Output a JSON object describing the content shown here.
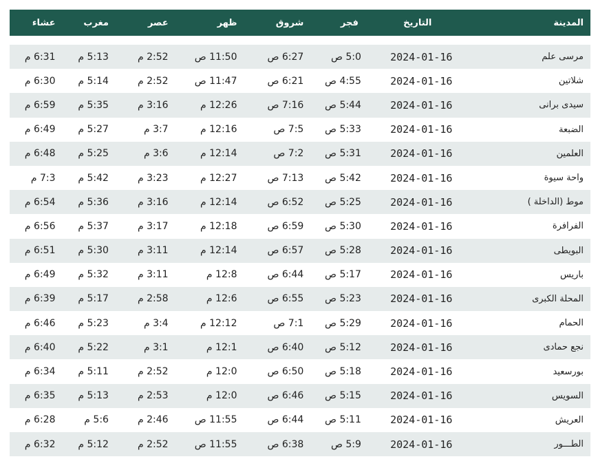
{
  "table": {
    "headers": [
      "المدينة",
      "التاريخ",
      "فجر",
      "شروق",
      "ظهر",
      "عصر",
      "مغرب",
      "عشاء"
    ],
    "rows": [
      [
        "مرسى علم",
        "2024-01-16",
        "5:0 ص",
        "6:27 ص",
        "11:50 ص",
        "2:52 م",
        "5:13 م",
        "6:31 م"
      ],
      [
        "شلاتين",
        "2024-01-16",
        "4:55 ص",
        "6:21 ص",
        "11:47 ص",
        "2:52 م",
        "5:14 م",
        "6:30 م"
      ],
      [
        "سيدى برانى",
        "2024-01-16",
        "5:44 ص",
        "7:16 ص",
        "12:26 م",
        "3:16 م",
        "5:35 م",
        "6:59 م"
      ],
      [
        "الضبعة",
        "2024-01-16",
        "5:33 ص",
        "7:5 ص",
        "12:16 م",
        "3:7 م",
        "5:27 م",
        "6:49 م"
      ],
      [
        "العلمين",
        "2024-01-16",
        "5:31 ص",
        "7:2 ص",
        "12:14 م",
        "3:6 م",
        "5:25 م",
        "6:48 م"
      ],
      [
        "واحة سيوة",
        "2024-01-16",
        "5:42 ص",
        "7:13 ص",
        "12:27 م",
        "3:23 م",
        "5:42 م",
        "7:3 م"
      ],
      [
        "موط (الداخلة )",
        "2024-01-16",
        "5:25 ص",
        "6:52 ص",
        "12:14 م",
        "3:16 م",
        "5:36 م",
        "6:54 م"
      ],
      [
        "الفرافرة",
        "2024-01-16",
        "5:30 ص",
        "6:59 ص",
        "12:18 م",
        "3:17 م",
        "5:37 م",
        "6:56 م"
      ],
      [
        "البويطى",
        "2024-01-16",
        "5:28 ص",
        "6:57 ص",
        "12:14 م",
        "3:11 م",
        "5:30 م",
        "6:51 م"
      ],
      [
        "باريس",
        "2024-01-16",
        "5:17 ص",
        "6:44 ص",
        "12:8 م",
        "3:11 م",
        "5:32 م",
        "6:49 م"
      ],
      [
        "المحلة الكبرى",
        "2024-01-16",
        "5:23 ص",
        "6:55 ص",
        "12:6 م",
        "2:58 م",
        "5:17 م",
        "6:39 م"
      ],
      [
        "الحمام",
        "2024-01-16",
        "5:29 ص",
        "7:1 ص",
        "12:12 م",
        "3:4 م",
        "5:23 م",
        "6:46 م"
      ],
      [
        "نجع حمادى",
        "2024-01-16",
        "5:12 ص",
        "6:40 ص",
        "12:1 م",
        "3:1 م",
        "5:22 م",
        "6:40 م"
      ],
      [
        "بورسعيد",
        "2024-01-16",
        "5:18 ص",
        "6:50 ص",
        "12:0 م",
        "2:52 م",
        "5:11 م",
        "6:34 م"
      ],
      [
        "السويس",
        "2024-01-16",
        "5:15 ص",
        "6:46 ص",
        "12:0 م",
        "2:53 م",
        "5:13 م",
        "6:35 م"
      ],
      [
        "العريش",
        "2024-01-16",
        "5:11 ص",
        "6:44 ص",
        "11:55 ص",
        "2:46 م",
        "5:6 م",
        "6:28 م"
      ],
      [
        "الطـــور",
        "2024-01-16",
        "5:9 ص",
        "6:38 ص",
        "11:55 ص",
        "2:52 م",
        "5:12 م",
        "6:32 م"
      ]
    ]
  }
}
